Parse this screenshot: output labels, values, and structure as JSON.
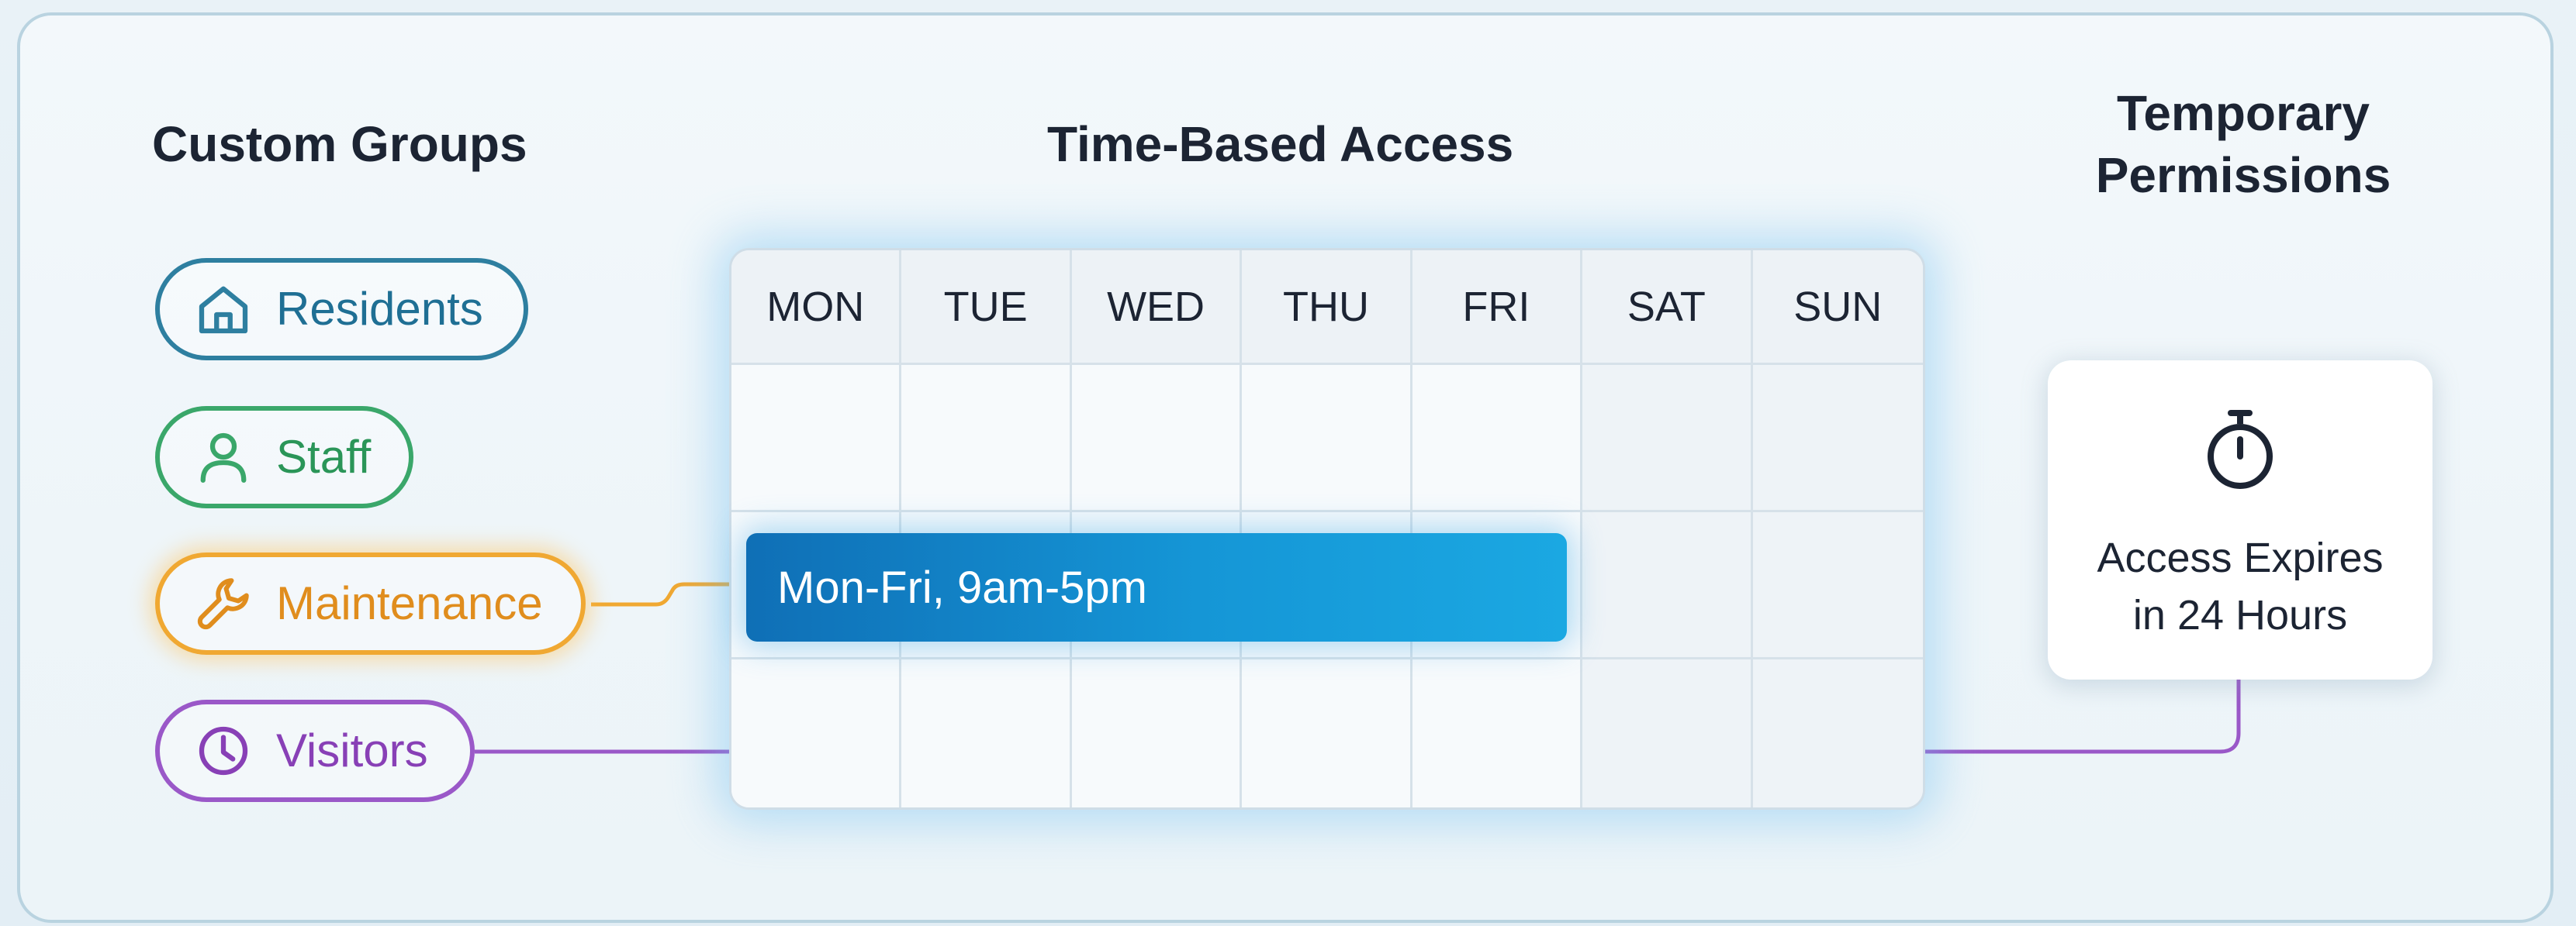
{
  "headings": {
    "custom_groups": "Custom Groups",
    "time_based_access": "Time-Based Access",
    "temporary_permissions_line1": "Temporary",
    "temporary_permissions_line2": "Permissions"
  },
  "groups": [
    {
      "label": "Residents",
      "icon": "home-icon",
      "color": "#2e7fa0"
    },
    {
      "label": "Staff",
      "icon": "user-icon",
      "color": "#3aa76a"
    },
    {
      "label": "Maintenance",
      "icon": "wrench-icon",
      "color": "#f0a832"
    },
    {
      "label": "Visitors",
      "icon": "clock-icon",
      "color": "#9a58c8"
    }
  ],
  "calendar": {
    "days": [
      "MON",
      "TUE",
      "WED",
      "THU",
      "FRI",
      "SAT",
      "SUN"
    ],
    "schedule_label": "Mon-Fri, 9am-5pm"
  },
  "temporary": {
    "icon": "stopwatch-icon",
    "line1": "Access Expires",
    "line2": "in 24 Hours"
  }
}
